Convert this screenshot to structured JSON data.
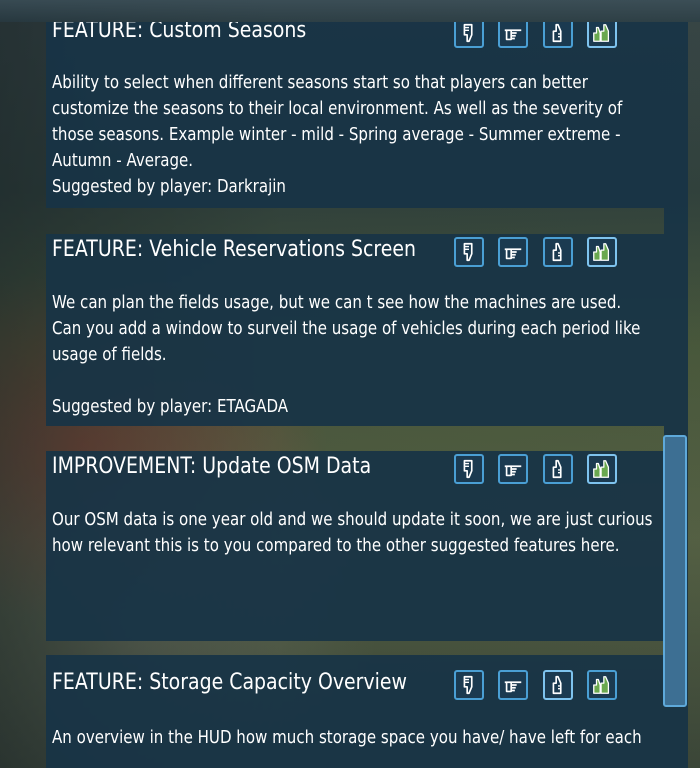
{
  "suggestions": [
    {
      "title": "FEATURE: Custom Seasons",
      "body": "Ability to select when different seasons start so that players can better customize the seasons to their local environment. As well as the severity of those seasons. Example winter - mild - Spring average - Summer extreme - Autumn - Average.",
      "suggested_by": "Suggested by player: Darkrajin",
      "selected_vote": "strongly-agree"
    },
    {
      "title": "FEATURE: Vehicle Reservations Screen",
      "body": "We can plan the fields usage, but we can t see how the machines are used. Can you add a window to surveil the usage of vehicles during each period like usage of fields.",
      "suggested_by": "Suggested by player: ETAGADA",
      "selected_vote": "strongly-agree"
    },
    {
      "title": "IMPROVEMENT: Update OSM Data",
      "body": "Our OSM data is one year old and we should update it soon, we are just curious how relevant this is to you compared to the other suggested features here.",
      "suggested_by": "",
      "selected_vote": "strongly-agree"
    },
    {
      "title": "FEATURE: Storage Capacity Overview",
      "body": "An overview in the HUD how much storage space you have/ have left for each",
      "suggested_by": "",
      "selected_vote": "agree"
    }
  ],
  "vote_options": [
    {
      "icon": "thumbs-down-icon",
      "label": "disagree"
    },
    {
      "icon": "pointing-hand-icon",
      "label": "neutral"
    },
    {
      "icon": "thumbs-up-icon",
      "label": "agree"
    },
    {
      "icon": "double-thumbs-up-icon",
      "label": "strongly-agree"
    }
  ],
  "colors": {
    "card_bg": "#18344a",
    "button_border": "#4a9fd4",
    "selected_icon": "#6aa84f",
    "text": "#ffffff"
  }
}
